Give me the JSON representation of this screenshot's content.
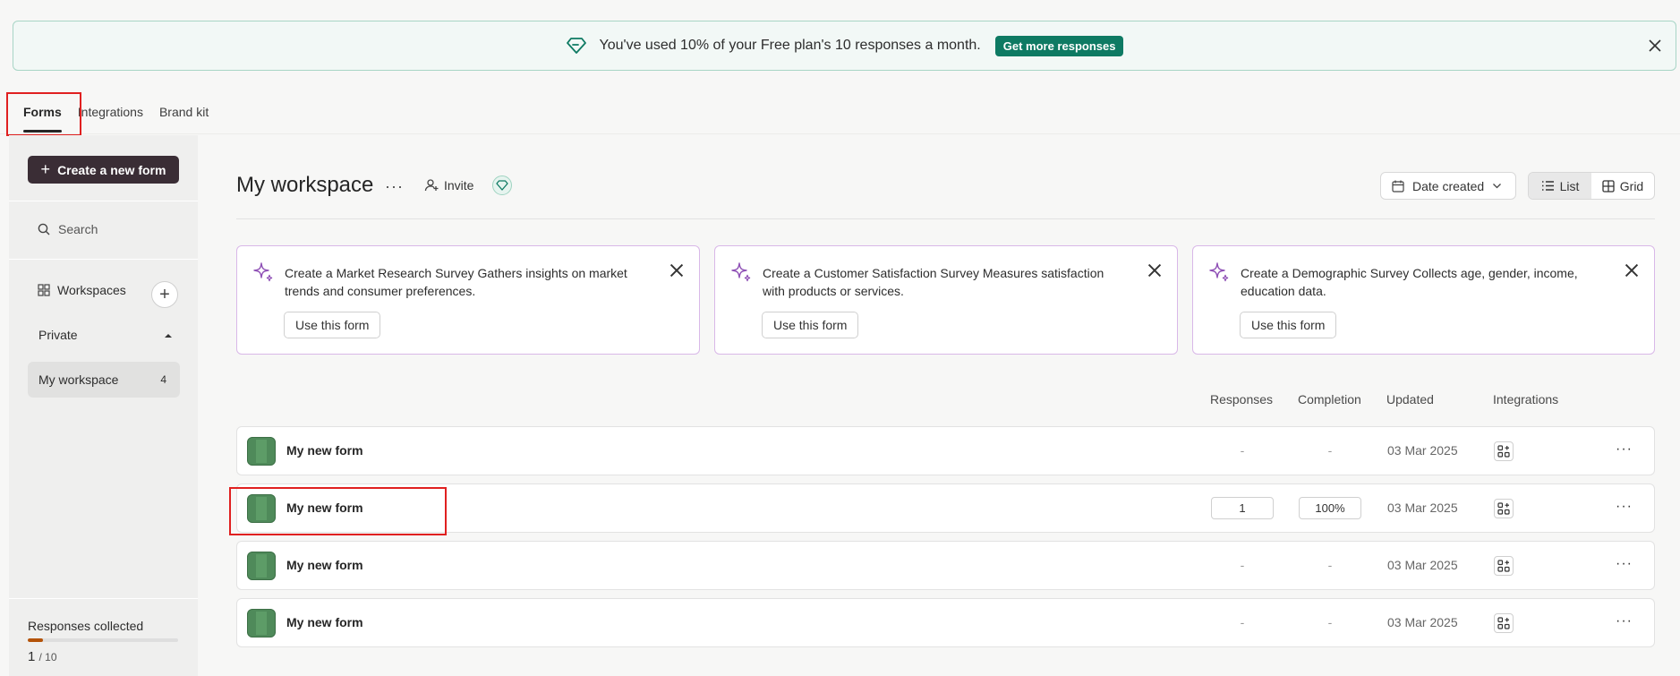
{
  "banner": {
    "text": "You've used 10% of your Free plan's 10 responses a month.",
    "button": "Get more responses"
  },
  "tabs": [
    {
      "label": "Forms",
      "active": true
    },
    {
      "label": "Integrations",
      "active": false
    },
    {
      "label": "Brand kit",
      "active": false
    }
  ],
  "sidebar": {
    "create_button": "Create a new form",
    "search_placeholder": "Search",
    "workspaces_label": "Workspaces",
    "private_label": "Private",
    "workspace_item": {
      "label": "My workspace",
      "count": "4"
    },
    "responses_label": "Responses collected",
    "responses_used": "1",
    "responses_limit": "/ 10",
    "responses_fraction": 0.1
  },
  "main": {
    "title": "My workspace",
    "more_label": "···",
    "invite_label": "Invite",
    "sort_label": "Date created",
    "view_list": "List",
    "view_grid": "Grid"
  },
  "templates": [
    {
      "text": "Create a Market Research Survey Gathers insights on market trends and consumer preferences.",
      "button": "Use this form"
    },
    {
      "text": "Create a Customer Satisfaction Survey Measures satisfaction with products or services.",
      "button": "Use this form"
    },
    {
      "text": "Create a Demographic Survey Collects age, gender, income, education data.",
      "button": "Use this form"
    }
  ],
  "columns": {
    "responses": "Responses",
    "completion": "Completion",
    "updated": "Updated",
    "integrations": "Integrations"
  },
  "forms": [
    {
      "name": "My new form",
      "responses": "-",
      "completion": "-",
      "updated": "03 Mar 2025",
      "more": "···"
    },
    {
      "name": "My new form",
      "responses": "1",
      "completion": "100%",
      "updated": "03 Mar 2025",
      "more": "···"
    },
    {
      "name": "My new form",
      "responses": "-",
      "completion": "-",
      "updated": "03 Mar 2025",
      "more": "···"
    },
    {
      "name": "My new form",
      "responses": "-",
      "completion": "-",
      "updated": "03 Mar 2025",
      "more": "···"
    }
  ],
  "colors": {
    "accent_green": "#0e7a63",
    "create_button_bg": "#3a2d35",
    "card_border": "#d9b8e8",
    "highlight_box": "#e02020",
    "progress_fill": "#b45309"
  }
}
